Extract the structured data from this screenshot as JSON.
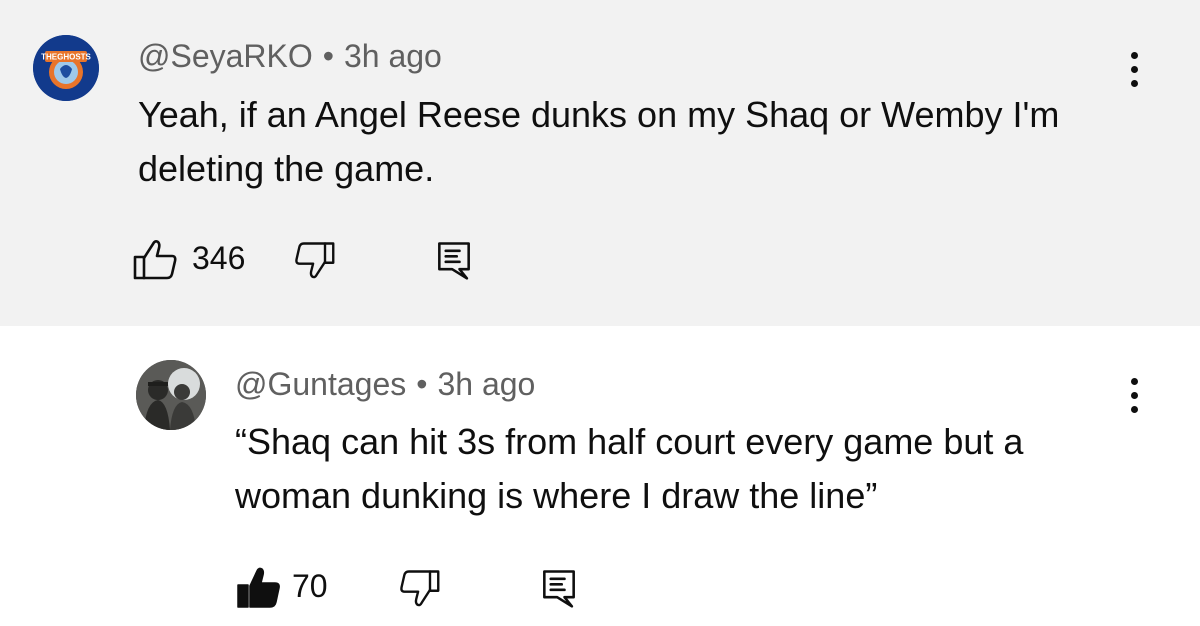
{
  "comments": [
    {
      "handle": "@SeyaRKO",
      "separator": "•",
      "time": "3h ago",
      "text": "Yeah, if an Angel Reese dunks on my Shaq or Wemby I'm deleting the game.",
      "likes": "346",
      "liked": false,
      "avatar_logo_text": "THEGHOSTS",
      "avatar_color": "#123a8c"
    },
    {
      "handle": "@Guntages",
      "separator": "•",
      "time": "3h ago",
      "text": "“Shaq can hit 3s from half court every game but a woman dunking is where I draw the line”",
      "likes": "70",
      "liked": true,
      "avatar_color": "#4a4a48"
    }
  ],
  "icons": {
    "like": "thumbs-up-icon",
    "dislike": "thumbs-down-icon",
    "reply": "reply-icon",
    "more": "more-vertical-icon"
  },
  "colors": {
    "highlight_background": "#f2f2f2",
    "meta_text": "#606060",
    "primary_text": "#0f0f0f"
  }
}
